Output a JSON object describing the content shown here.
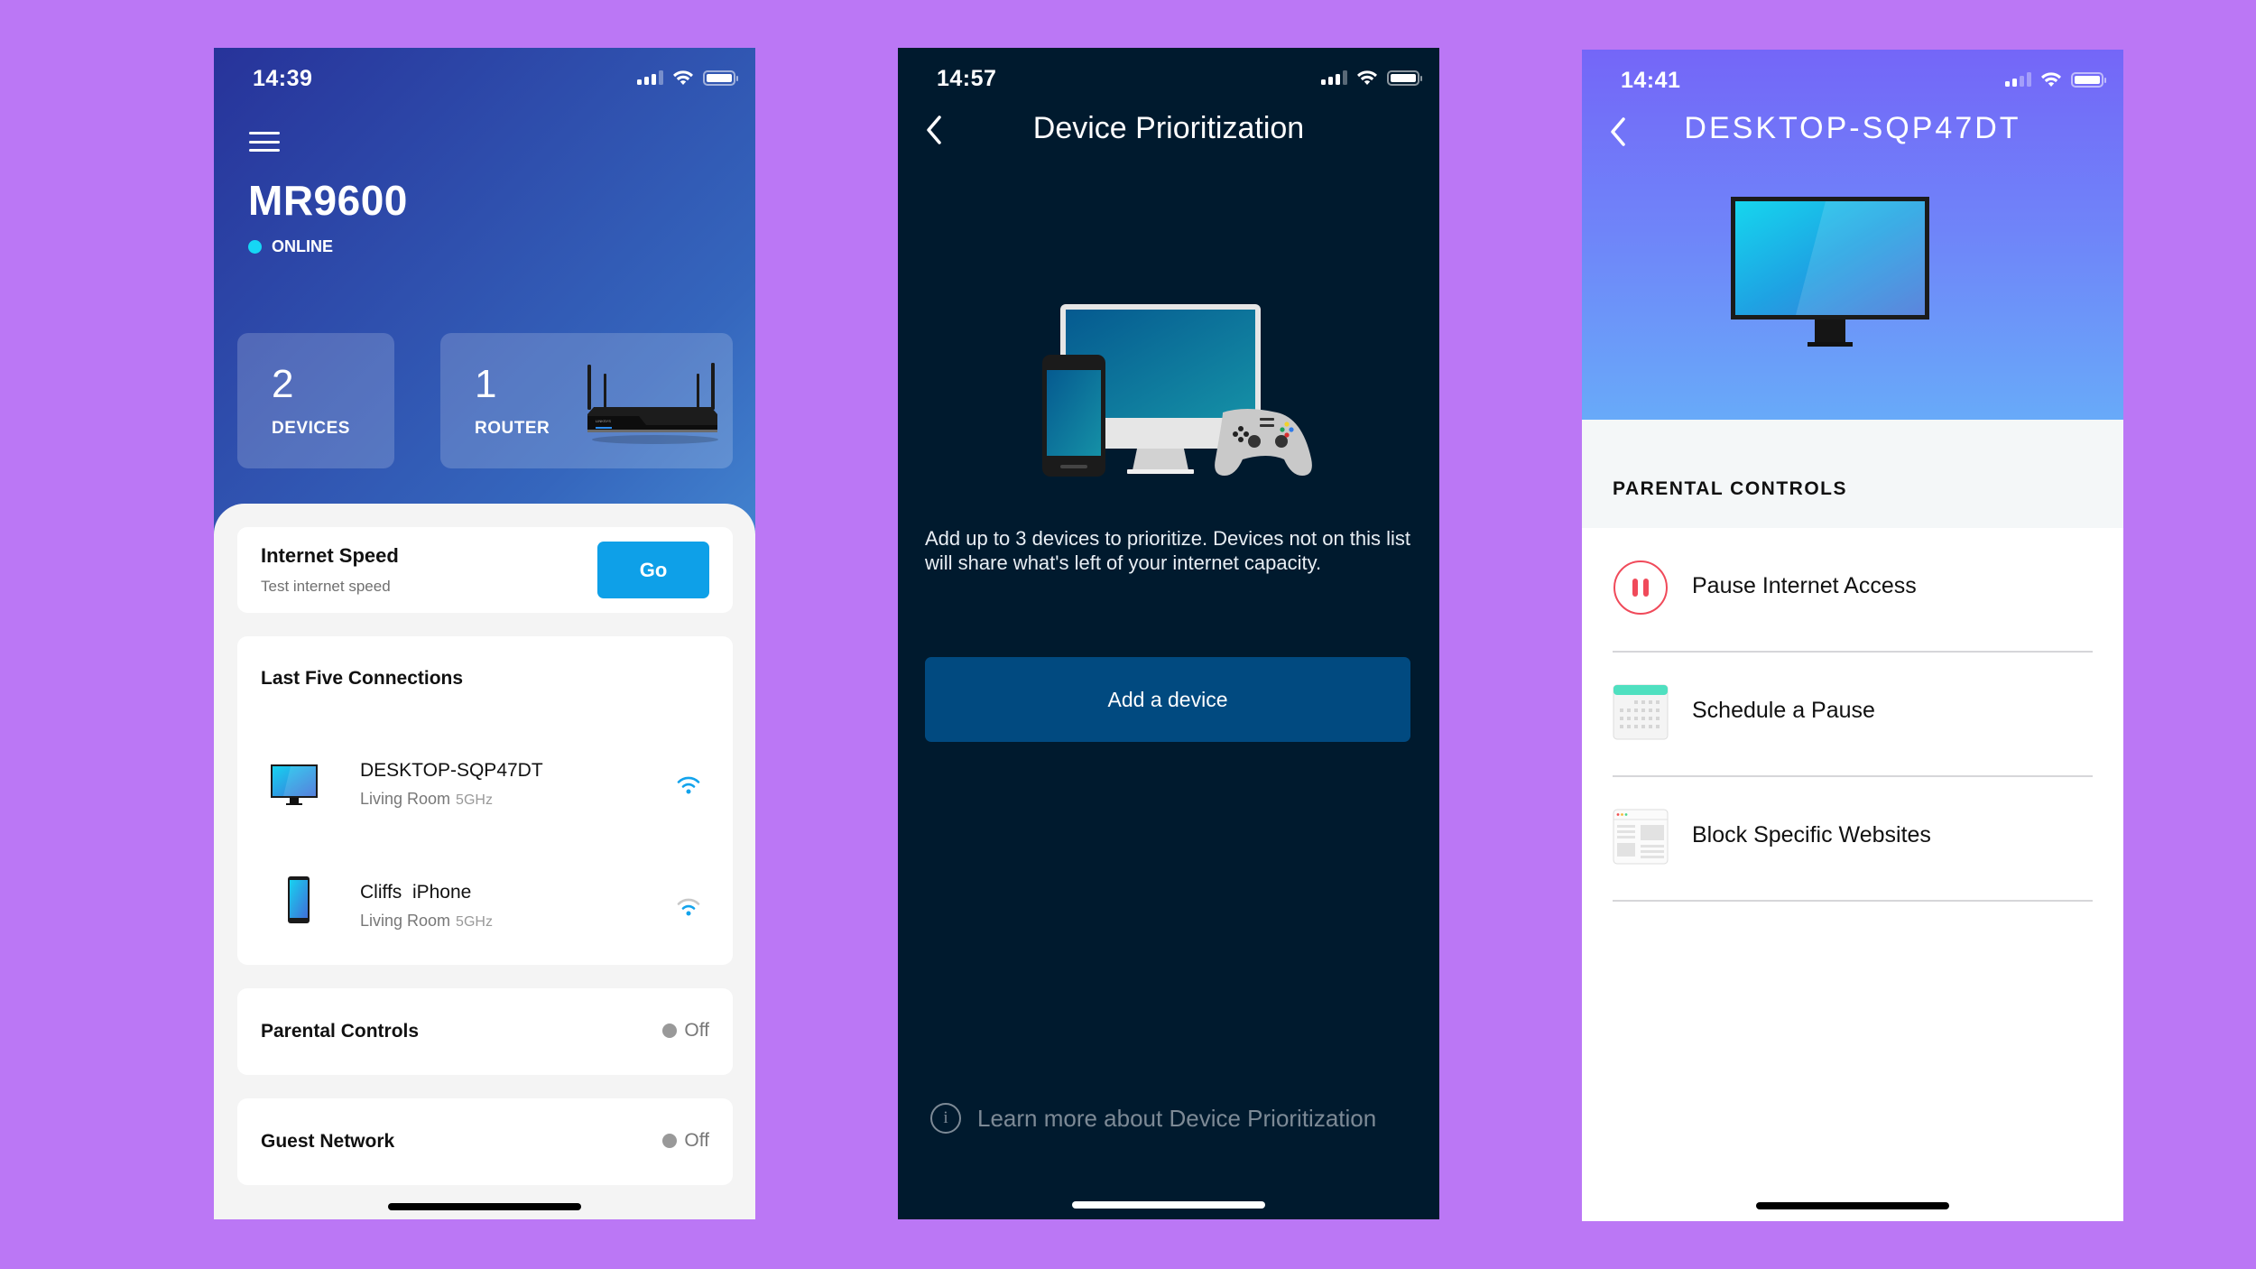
{
  "background_color": "#bb77f5",
  "screens": [
    {
      "id": "home",
      "status_bar": {
        "time": "14:39",
        "signal_bars_active": 3,
        "signal_bars_total": 4,
        "wifi": "wifi-icon",
        "battery": "battery-full-icon"
      },
      "menu_icon": "hamburger-menu-icon",
      "router_name": "MR9600",
      "status": {
        "label": "ONLINE",
        "color": "#16d7f5"
      },
      "stats": [
        {
          "value": "2",
          "label": "DEVICES"
        },
        {
          "value": "1",
          "label": "ROUTER",
          "image": "router-icon"
        }
      ],
      "internet_speed": {
        "title": "Internet Speed",
        "subtitle": "Test internet speed",
        "button_label": "Go",
        "button_color": "#0ea0e8"
      },
      "connections": {
        "title": "Last Five Connections",
        "items": [
          {
            "name": "DESKTOP-SQP47DT",
            "location": "Living Room",
            "band": "5GHz",
            "device_icon": "desktop-monitor-icon",
            "signal_strength": "full"
          },
          {
            "name": "Cliffs  iPhone",
            "location": "Living Room",
            "band": "5GHz",
            "device_icon": "smartphone-icon",
            "signal_strength": "medium"
          }
        ]
      },
      "settings": [
        {
          "label": "Parental Controls",
          "state": "Off"
        },
        {
          "label": "Guest Network",
          "state": "Off"
        }
      ]
    },
    {
      "id": "device-prioritization",
      "status_bar": {
        "time": "14:57",
        "signal_bars_active": 3,
        "signal_bars_total": 4,
        "wifi": "wifi-icon",
        "battery": "battery-full-icon"
      },
      "back_icon": "chevron-left-icon",
      "title": "Device Prioritization",
      "illustration": "devices-illustration",
      "description": "Add up to 3 devices to prioritize. Devices not on this list will share what's left of your internet capacity.",
      "button_label": "Add a device",
      "button_color": "#014a80",
      "learn_more": "Learn more about Device Prioritization",
      "background_color": "#001a2e"
    },
    {
      "id": "device-detail",
      "status_bar": {
        "time": "14:41",
        "signal_bars_active": 2,
        "signal_bars_total": 4,
        "wifi": "wifi-icon",
        "battery": "battery-full-icon"
      },
      "back_icon": "chevron-left-icon",
      "title": "DESKTOP-SQP47DT",
      "device_icon": "desktop-monitor-icon",
      "section_title": "PARENTAL CONTROLS",
      "options": [
        {
          "label": "Pause Internet Access",
          "icon": "pause-circle-icon",
          "icon_color": "#f04a5a"
        },
        {
          "label": "Schedule a Pause",
          "icon": "calendar-icon",
          "icon_color": "#4fe0c0"
        },
        {
          "label": "Block Specific Websites",
          "icon": "browser-window-icon"
        }
      ]
    }
  ]
}
